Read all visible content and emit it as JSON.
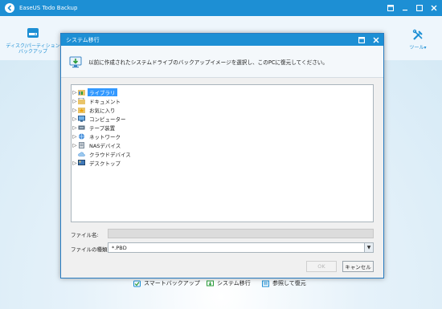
{
  "app": {
    "title": "EaseUS Todo Backup",
    "toolbar": {
      "disk_backup_label_1": "ディスク/パーティション",
      "disk_backup_label_2": "バックアップ",
      "tools_label": "ツール▾"
    },
    "bottom_links": {
      "smart_backup": "スマートバックアップ",
      "system_migration": "システム移行",
      "browse_restore": "参照して復元"
    }
  },
  "dialog": {
    "title": "システム移行",
    "instruction": "以前に作成されたシステムドライブのバックアップイメージを選択し、このPCに復元してください。",
    "tree": [
      {
        "label": "ライブラリ",
        "expandable": true,
        "selected": true,
        "icon": "library-icon"
      },
      {
        "label": "ドキュメント",
        "expandable": true,
        "selected": false,
        "icon": "documents-icon"
      },
      {
        "label": "お気に入り",
        "expandable": true,
        "selected": false,
        "icon": "favorites-icon"
      },
      {
        "label": "コンピューター",
        "expandable": true,
        "selected": false,
        "icon": "computer-icon"
      },
      {
        "label": "テープ装置",
        "expandable": true,
        "selected": false,
        "icon": "tape-drive-icon"
      },
      {
        "label": "ネットワーク",
        "expandable": true,
        "selected": false,
        "icon": "network-icon"
      },
      {
        "label": "NASデバイス",
        "expandable": true,
        "selected": false,
        "icon": "nas-device-icon"
      },
      {
        "label": "クラウドデバイス",
        "expandable": false,
        "selected": false,
        "icon": "cloud-icon"
      },
      {
        "label": "デスクトップ",
        "expandable": true,
        "selected": false,
        "icon": "desktop-icon"
      }
    ],
    "file_name_label": "ファイル名:",
    "file_name_value": "",
    "file_type_label": "ファイルの種類:",
    "file_type_value": "*.PBD",
    "ok_label": "OK",
    "cancel_label": "キャンセル"
  }
}
